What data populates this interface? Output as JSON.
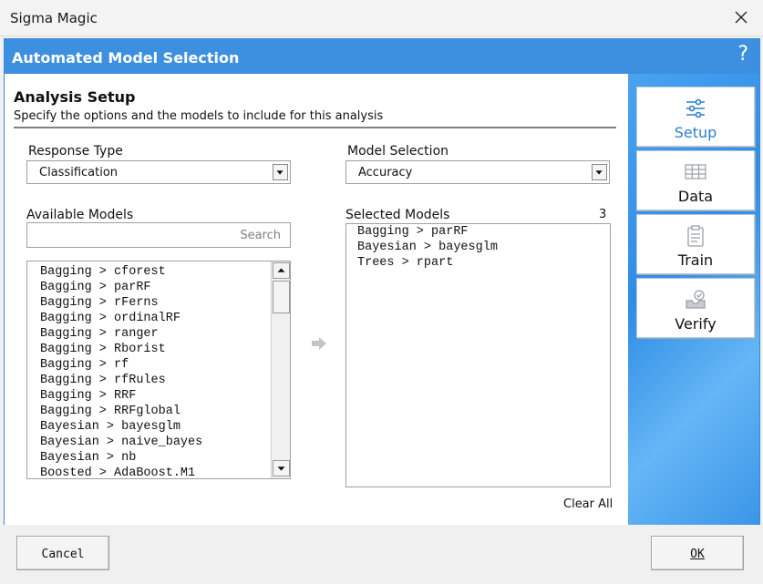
{
  "window": {
    "title": "Sigma Magic"
  },
  "header": {
    "title": "Automated Model Selection",
    "help": "?"
  },
  "section": {
    "title": "Analysis Setup",
    "subtitle": "Specify the options and the models to include for this analysis"
  },
  "response_type": {
    "label": "Response Type",
    "value": "Classification"
  },
  "model_selection": {
    "label": "Model Selection",
    "value": "Accuracy"
  },
  "available_models": {
    "label": "Available Models",
    "search_placeholder": "Search",
    "items": [
      "Bagging > cforest",
      "Bagging > parRF",
      "Bagging > rFerns",
      "Bagging > ordinalRF",
      "Bagging > ranger",
      "Bagging > Rborist",
      "Bagging > rf",
      "Bagging > rfRules",
      "Bagging > RRF",
      "Bagging > RRFglobal",
      "Bayesian > bayesglm",
      "Bayesian > naive_bayes",
      "Bayesian > nb",
      "Boosted > AdaBoost.M1"
    ]
  },
  "selected_models": {
    "label": "Selected Models",
    "count": "3",
    "items": [
      "Bagging > parRF",
      "Bayesian > bayesglm",
      "Trees > rpart"
    ],
    "clear_label": "Clear All"
  },
  "sidebar": {
    "items": [
      {
        "label": "Setup",
        "icon": "sliders-icon",
        "active": true
      },
      {
        "label": "Data",
        "icon": "table-icon",
        "active": false
      },
      {
        "label": "Train",
        "icon": "clipboard-icon",
        "active": false
      },
      {
        "label": "Verify",
        "icon": "inbox-check-icon",
        "active": false
      }
    ]
  },
  "footer": {
    "cancel_label": "Cancel",
    "ok_label": "OK"
  },
  "colors": {
    "accent": "#3d8fe0",
    "active_text": "#2d7ed0"
  }
}
